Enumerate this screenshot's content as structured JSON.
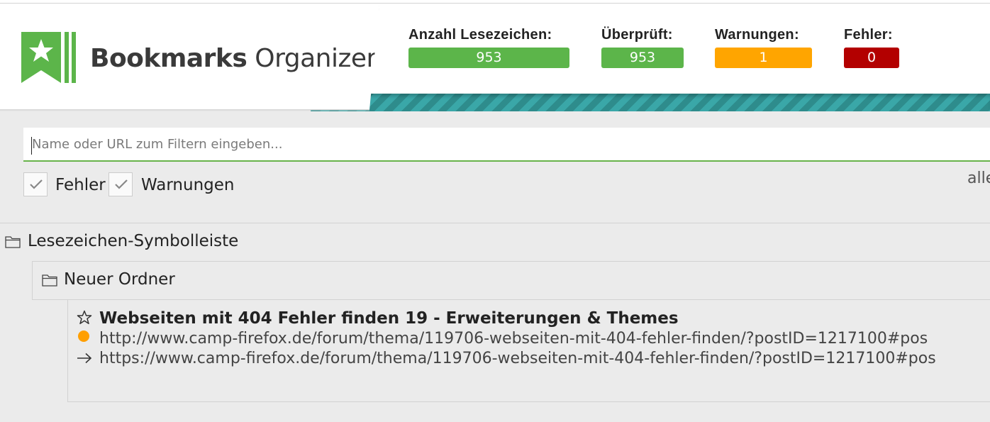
{
  "app": {
    "name_bold": "Bookmarks",
    "name_light": "Organizer"
  },
  "stats": {
    "total": {
      "label": "Anzahl Lesezeichen:",
      "value": "953",
      "color": "#5cb54a"
    },
    "checked": {
      "label": "Überprüft:",
      "value": "953",
      "color": "#5cb54a"
    },
    "warnings": {
      "label": "Warnungen:",
      "value": "1",
      "color": "#ffa500"
    },
    "errors": {
      "label": "Fehler:",
      "value": "0",
      "color": "#b30000"
    }
  },
  "filter": {
    "placeholder": "Name oder URL zum Filtern eingeben...",
    "value": ""
  },
  "checkboxes": {
    "errors": {
      "label": "Fehler",
      "checked": true
    },
    "warnings": {
      "label": "Warnungen",
      "checked": true
    }
  },
  "alle_label": "alle",
  "tree": {
    "root_folder": "Lesezeichen-Symbolleiste",
    "sub_folder": "Neuer Ordner",
    "bookmark": {
      "title": "Webseiten mit 404 Fehler finden 19 - Erweiterungen & Themes",
      "url": "http://www.camp-firefox.de/forum/thema/119706-webseiten-mit-404-fehler-finden/?postID=1217100#pos",
      "redirect_url": "https://www.camp-firefox.de/forum/thema/119706-webseiten-mit-404-fehler-finden/?postID=1217100#pos",
      "status_color": "#ff9f00"
    }
  }
}
